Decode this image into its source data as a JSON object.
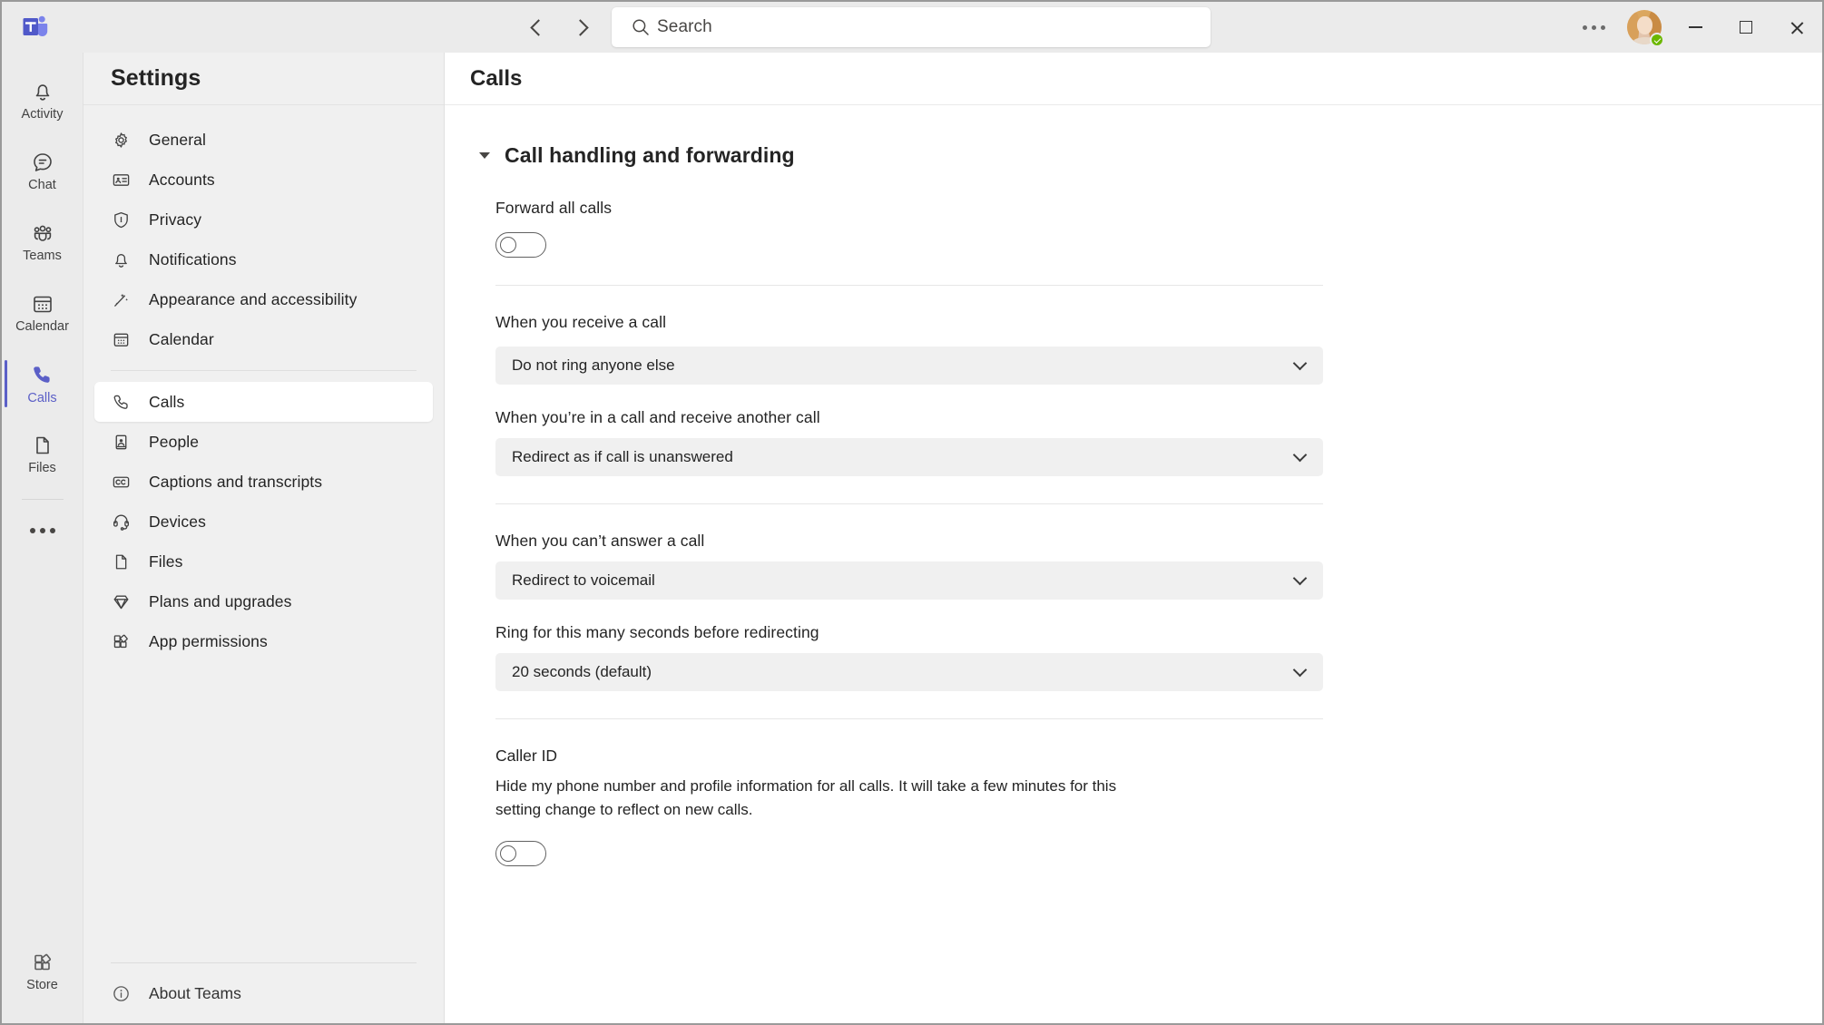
{
  "titlebar": {
    "logo_name": "microsoft-teams-logo",
    "back_label": "Back",
    "forward_label": "Forward",
    "search_placeholder": "Search",
    "more_label": "Settings and more",
    "avatar_label": "Account manager",
    "presence_status": "Available",
    "minimize_label": "Minimize",
    "maximize_label": "Maximize",
    "close_label": "Close"
  },
  "rail": {
    "items": [
      {
        "label": "Activity",
        "icon": "bell-icon",
        "active": false
      },
      {
        "label": "Chat",
        "icon": "chat-icon",
        "active": false
      },
      {
        "label": "Teams",
        "icon": "teams-icon",
        "active": false
      },
      {
        "label": "Calendar",
        "icon": "calendar-icon",
        "active": false
      },
      {
        "label": "Calls",
        "icon": "phone-icon",
        "active": true
      },
      {
        "label": "Files",
        "icon": "file-icon",
        "active": false
      }
    ],
    "more_label": "More apps",
    "store": {
      "label": "Store",
      "icon": "store-icon"
    },
    "accent_color": "#5b5fc7"
  },
  "sidebar": {
    "title": "Settings",
    "group_one": [
      {
        "label": "General",
        "icon": "gear-icon"
      },
      {
        "label": "Accounts",
        "icon": "id-card-icon"
      },
      {
        "label": "Privacy",
        "icon": "shield-icon"
      },
      {
        "label": "Notifications",
        "icon": "bell-icon"
      },
      {
        "label": "Appearance and accessibility",
        "icon": "magic-wand-icon"
      },
      {
        "label": "Calendar",
        "icon": "calendar-icon"
      }
    ],
    "group_two": [
      {
        "label": "Calls",
        "icon": "phone-icon",
        "selected": true
      },
      {
        "label": "People",
        "icon": "person-card-icon",
        "selected": false
      },
      {
        "label": "Captions and transcripts",
        "icon": "cc-icon",
        "selected": false
      },
      {
        "label": "Devices",
        "icon": "headset-icon",
        "selected": false
      },
      {
        "label": "Files",
        "icon": "file-icon",
        "selected": false
      },
      {
        "label": "Plans and upgrades",
        "icon": "diamond-icon",
        "selected": false
      },
      {
        "label": "App permissions",
        "icon": "apps-icon",
        "selected": false
      }
    ],
    "about": {
      "label": "About Teams",
      "icon": "info-icon"
    }
  },
  "main": {
    "title": "Calls",
    "section": {
      "title": "Call handling and forwarding",
      "expanded": true
    },
    "forward_all_calls": {
      "label": "Forward all calls",
      "toggle_state": "off"
    },
    "receive_call": {
      "label": "When you receive a call",
      "value": "Do not ring anyone else"
    },
    "in_call_another": {
      "label": "When you’re in a call and receive another call",
      "value": "Redirect as if call is unanswered"
    },
    "cant_answer": {
      "label": "When you can’t answer a call",
      "value": "Redirect to voicemail"
    },
    "ring_seconds": {
      "label": "Ring for this many seconds before redirecting",
      "value": "20 seconds (default)"
    },
    "caller_id": {
      "label": "Caller ID",
      "description": "Hide my phone number and profile information for all calls. It will take a few minutes for this setting change to reflect on new calls.",
      "toggle_state": "off"
    }
  }
}
